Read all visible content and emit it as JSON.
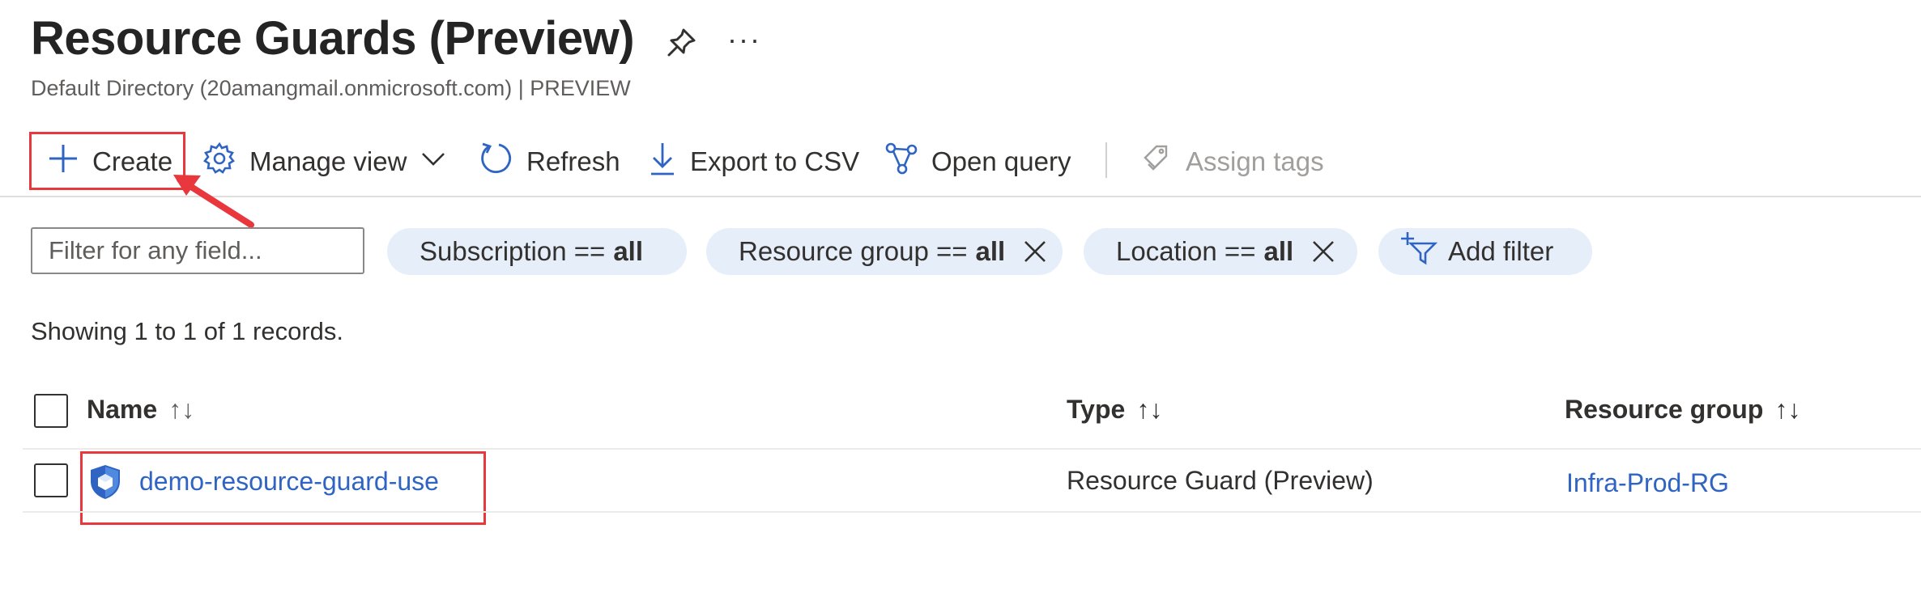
{
  "page": {
    "title": "Resource Guards (Preview)",
    "subtitle": "Default Directory (20amangmail.onmicrosoft.com) | PREVIEW",
    "more_label": "···"
  },
  "toolbar": {
    "create_label": "Create",
    "manage_view_label": "Manage view",
    "refresh_label": "Refresh",
    "export_label": "Export to CSV",
    "open_query_label": "Open query",
    "assign_tags_label": "Assign tags"
  },
  "filters": {
    "search_placeholder": "Filter for any field...",
    "subscription": {
      "label": "Subscription ==",
      "value": "all"
    },
    "resource_group": {
      "label": "Resource group ==",
      "value": "all"
    },
    "location": {
      "label": "Location ==",
      "value": "all"
    },
    "add_filter_label": "Add filter"
  },
  "records_text": "Showing 1 to 1 of 1 records.",
  "table": {
    "columns": [
      {
        "label": "Name",
        "sort": "↑↓"
      },
      {
        "label": "Type",
        "sort": "↑↓"
      },
      {
        "label": "Resource group",
        "sort": "↑↓"
      }
    ],
    "rows": [
      {
        "name": "demo-resource-guard-use",
        "type": "Resource Guard (Preview)",
        "resource_group": "Infra-Prod-RG",
        "icon": "resource-guard-shield-icon"
      }
    ]
  },
  "colors": {
    "accent": "#2f64c2",
    "pill_bg": "#e6eef9",
    "annotation_red": "#e8383d"
  }
}
